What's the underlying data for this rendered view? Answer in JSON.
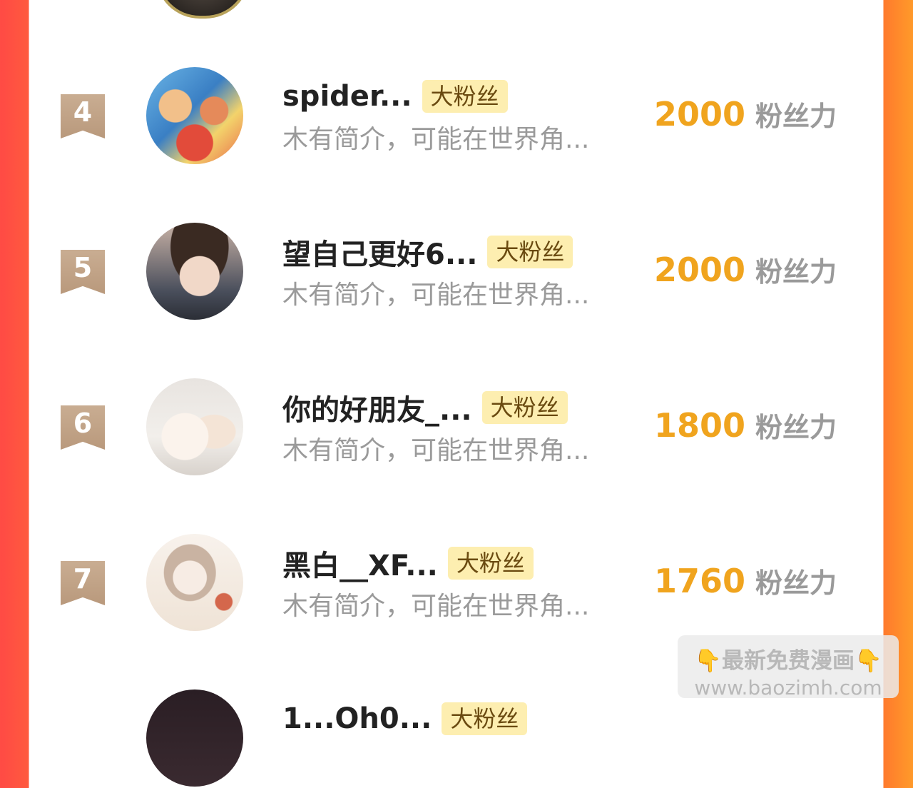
{
  "score_unit": "粉丝力",
  "badge": "大粉丝",
  "entries": [
    {
      "rank": "4",
      "name": "spider...",
      "bio": "木有简介，可能在世界角...",
      "score": "2000"
    },
    {
      "rank": "5",
      "name": "望自己更好6...",
      "bio": "木有简介，可能在世界角...",
      "score": "2000"
    },
    {
      "rank": "6",
      "name": "你的好朋友_...",
      "bio": "木有简介，可能在世界角...",
      "score": "1800"
    },
    {
      "rank": "7",
      "name": "黑白__XF...",
      "bio": "木有简介，可能在世界角...",
      "score": "1760"
    },
    {
      "rank": "",
      "name": "1...Oh0...",
      "bio": "",
      "score": ""
    }
  ],
  "watermark": {
    "line1": "最新免费漫画",
    "line2": "www.baozimh.com",
    "icon": "pointing-down-hand"
  },
  "colors": {
    "accent": "#f0a41e",
    "badge_bg": "#fdeeb0",
    "rank_bg": "#c9ad92"
  }
}
